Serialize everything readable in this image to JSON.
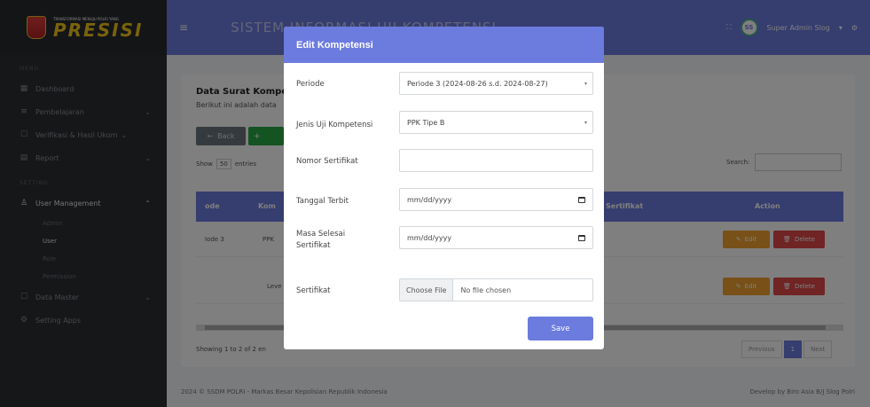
{
  "sidebar": {
    "brand_small": "TRANSFORMASI MENUJU POLRI YANG",
    "brand_big": "PRESISI",
    "section_main": "MENU",
    "section_settings": "SETTING",
    "items": [
      {
        "label": "Dashboard",
        "icon": "grid-icon"
      },
      {
        "label": "Pembelajaran",
        "icon": "book-icon"
      },
      {
        "label": "Verifikasi & Hasil Ukom",
        "icon": "check-icon"
      },
      {
        "label": "Report",
        "icon": "file-icon"
      }
    ],
    "user_management": "User Management",
    "sub_items": [
      "Admin",
      "User",
      "Role",
      "Permission"
    ],
    "data_master": "Data Master",
    "setting_apps": "Setting Apps"
  },
  "header": {
    "title": "SISTEM INFORMASI UJI KOMPETENSI",
    "user_initials": "SS",
    "user_name": "Super Admin Slog"
  },
  "page": {
    "card_title": "Data Surat Kompetensi",
    "card_subtitle": "Berikut ini adalah data",
    "back_label": "Back",
    "show_label": "Show",
    "entries_value": "50",
    "entries_label": "entries",
    "search_label": "Search:",
    "columns": [
      "ode",
      "Kom",
      "Sertifikat",
      "Action"
    ],
    "rows": [
      {
        "code": "Iode 3",
        "kom": "PPK"
      },
      {
        "code": "",
        "kom": "Leve"
      }
    ],
    "edit_label": "Edit",
    "delete_label": "Delete",
    "showing_text": "Showing 1 to 2 of 2 en",
    "pager_prev": "Previous",
    "pager_current": "1",
    "pager_next": "Next",
    "footer_left": "2024 © SSDM POLRI - Markas Besar Kepolisian Republik Indonesia",
    "footer_right": "Develop by Biro Asia B/J Slog Polri"
  },
  "modal": {
    "title": "Edit Kompetensi",
    "fields": [
      {
        "label": "Periode",
        "value": "Periode 3 (2024-08-26 s.d. 2024-08-27)",
        "type": "select"
      },
      {
        "label": "Jenis Uji Kompetensi",
        "value": "PPK Tipe B",
        "type": "select"
      },
      {
        "label": "Nomor Sertifikat",
        "value": "",
        "type": "text"
      },
      {
        "label": "Tanggal Terbit",
        "value": "mm/dd/yyyy",
        "type": "date"
      },
      {
        "label": "Masa Selesai Sertifikat",
        "value": "mm/dd/yyyy",
        "type": "date"
      },
      {
        "label": "Sertifikat",
        "button": "Choose File",
        "value": "No file chosen",
        "type": "file"
      }
    ],
    "save_label": "Save"
  }
}
